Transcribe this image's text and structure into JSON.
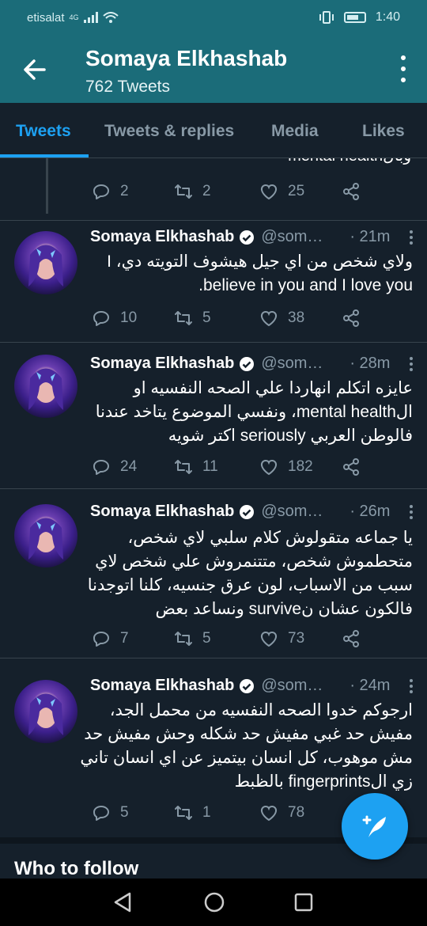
{
  "status_bar": {
    "carrier": "etisalat",
    "network": "4G",
    "time": "1:40"
  },
  "header": {
    "title": "Somaya Elkhashab",
    "subtitle": "762 Tweets"
  },
  "tabs": [
    {
      "label": "Tweets",
      "active": true
    },
    {
      "label": "Tweets & replies",
      "active": false
    },
    {
      "label": "Media",
      "active": false
    },
    {
      "label": "Likes",
      "active": false
    }
  ],
  "clipped_tweet": {
    "tail_text": "وبالmental health",
    "stats": {
      "replies": "2",
      "retweets": "2",
      "likes": "25"
    }
  },
  "tweets": [
    {
      "name": "Somaya Elkhashab",
      "handle": "@som…",
      "time": "· 21m",
      "lines": [
        "ولاي شخص من اي جيل هيشوف التويته دي، I",
        "believe in you and I love you."
      ],
      "stats": {
        "replies": "10",
        "retweets": "5",
        "likes": "38"
      }
    },
    {
      "name": "Somaya Elkhashab",
      "handle": "@som…",
      "time": "· 28m",
      "lines": [
        "عايزه اتكلم انهاردا علي الصحه النفسيه او",
        "الmental health، ونفسي الموضوع يتاخد عندنا",
        "فالوطن العربي seriously اكتر شويه"
      ],
      "stats": {
        "replies": "24",
        "retweets": "11",
        "likes": "182"
      }
    },
    {
      "name": "Somaya Elkhashab",
      "handle": "@som…",
      "time": "· 26m",
      "lines": [
        "يا جماعه متقولوش كلام سلبي لاي شخص،",
        "متحطموش شخص، متتنمروش علي شخص لاي",
        "سبب من الاسباب، لون عرق جنسيه، كلنا اتوجدنا",
        "فالكون عشان نsurvive ونساعد بعض"
      ],
      "stats": {
        "replies": "7",
        "retweets": "5",
        "likes": "73"
      }
    },
    {
      "name": "Somaya Elkhashab",
      "handle": "@som…",
      "time": "· 24m",
      "lines": [
        "ارجوكم خدوا الصحه النفسيه من محمل الجد،",
        "مفيش حد غبي مفيش حد شكله وحش مفيش حد",
        "مش موهوب، كل انسان بيتميز عن اي انسان تاني",
        "زي الfingerprints بالظبط"
      ],
      "stats": {
        "replies": "5",
        "retweets": "1",
        "likes": "78"
      }
    }
  ],
  "section": {
    "who_to_follow": "Who to follow"
  },
  "colors": {
    "accent": "#1da1f2",
    "header_bg": "#1b6c79",
    "page_bg": "#15202b",
    "muted": "#8899a6"
  }
}
